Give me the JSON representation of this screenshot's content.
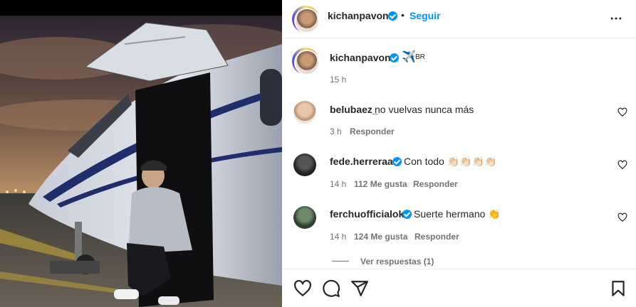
{
  "post": {
    "author": "kichanpavon",
    "follow_label": "Seguir",
    "separator": "•",
    "caption_author": "kichanpavon",
    "caption_emoji": "✈️",
    "caption_text": "BR",
    "time": "15 h"
  },
  "comments": [
    {
      "username": "belubaez_",
      "text": "no vuelvas nunca más",
      "time": "3 h",
      "likes": "",
      "reply_label": "Responder",
      "verified": false,
      "avatar_color": "#d9b59a"
    },
    {
      "username": "fede.herreraa",
      "text": "Con todo 👏🏻👏🏻👏🏻👏🏻",
      "time": "14 h",
      "likes": "112 Me gusta",
      "reply_label": "Responder",
      "verified": true,
      "avatar_color": "#2f2f2f"
    },
    {
      "username": "ferchuofficialok",
      "text": "Suerte hermano 👏",
      "time": "14 h",
      "likes": "124 Me gusta",
      "reply_label": "Responder",
      "verified": true,
      "avatar_color": "#3a4a3a"
    }
  ],
  "view_replies": "Ver respuestas (1)",
  "colors": {
    "accent": "#0095f6",
    "text": "#262626",
    "secondary": "#737373"
  },
  "icons": {
    "more": "more-horizontal-icon",
    "like": "heart-icon",
    "comment": "comment-icon",
    "share": "send-icon",
    "save": "bookmark-icon"
  }
}
